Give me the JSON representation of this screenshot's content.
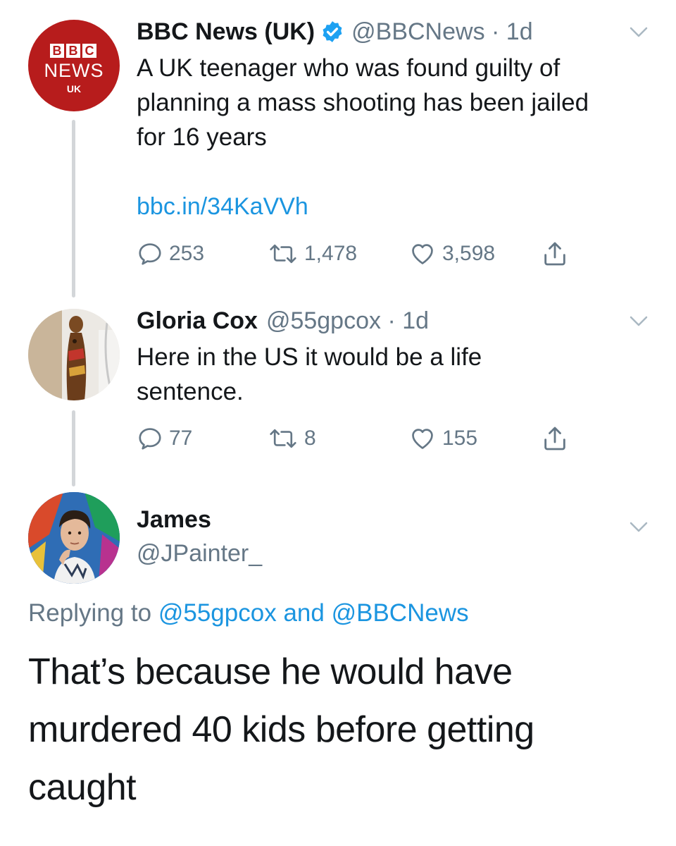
{
  "tweets": [
    {
      "name": "BBC News (UK)",
      "handle": "@BBCNews",
      "time": "1d",
      "text_lines": [
        "A UK teenager who was found guilty of",
        "planning a mass shooting has been jailed",
        "for 16 years"
      ],
      "link": "bbc.in/34KaVVh",
      "replies": "253",
      "retweets": "1,478",
      "likes": "3,598",
      "verified": true,
      "avatar": {
        "blocks": [
          "B",
          "B",
          "C"
        ],
        "word": "NEWS",
        "region": "UK",
        "bg_color": "#b71c1c"
      }
    },
    {
      "name": "Gloria Cox",
      "handle": "@55gpcox",
      "time": "1d",
      "text_lines": [
        "Here in the US it would be a life",
        "sentence."
      ],
      "replies": "77",
      "retweets": "8",
      "likes": "155"
    }
  ],
  "focused_tweet": {
    "name": "James",
    "handle": "@JPainter_",
    "replying_prefix": "Replying to",
    "replying_mention_1": "@55gpcox",
    "replying_and": "and",
    "replying_mention_2": "@BBCNews",
    "text_lines": [
      "That’s because he would have",
      "murdered 40 kids before getting",
      "caught"
    ]
  },
  "colors": {
    "link": "#1b95e0",
    "muted": "#657786",
    "verified": "#1da1f2",
    "thread_line": "#d3d6d9"
  },
  "icons": [
    "verified-badge-icon",
    "chevron-down-icon",
    "reply-icon",
    "retweet-icon",
    "like-icon",
    "share-icon"
  ]
}
